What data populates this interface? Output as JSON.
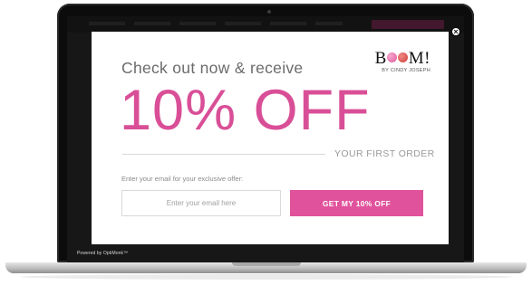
{
  "theme": {
    "accent": "#d94f97",
    "cta_bg": "#e0529b",
    "logo_o_colors": [
      "#e2569a",
      "#d23c38"
    ]
  },
  "popup": {
    "logo": {
      "wordmark_b": "B",
      "wordmark_rest": "M!",
      "tagline": "BY CINDY JOSEPH"
    },
    "headline": "Check out now & receive",
    "offer": "10% OFF",
    "offer_sub": "YOUR FIRST ORDER",
    "email_prompt": "Enter your email for your exclusive offer:",
    "email_placeholder": "Enter your email here",
    "cta_label": "GET MY 10% OFF",
    "close_glyph": "×"
  },
  "footer": {
    "powered_by": "Powered by OptiMonk™"
  },
  "icons": {
    "close": "close-icon"
  }
}
